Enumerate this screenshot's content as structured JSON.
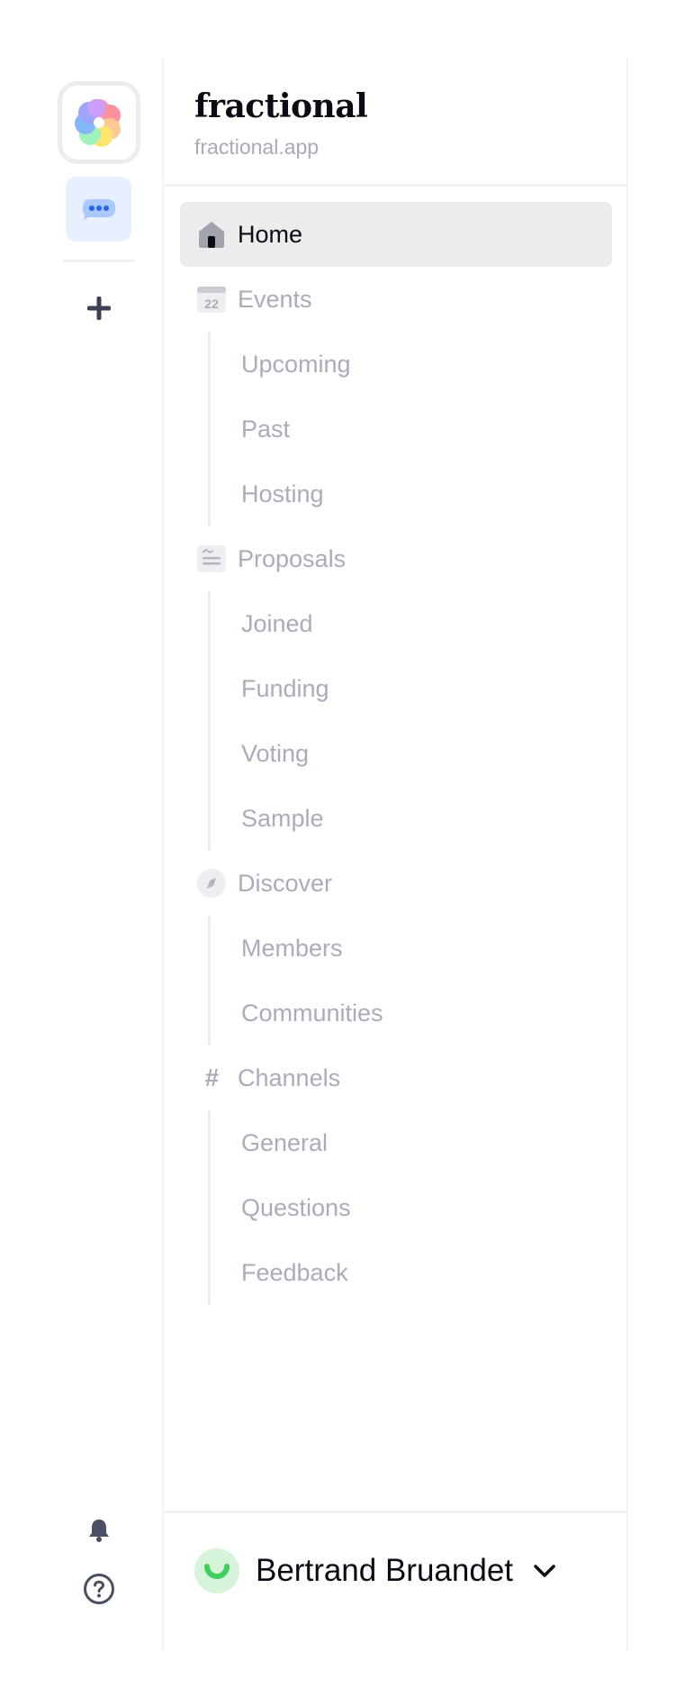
{
  "brand": {
    "title": "fractional",
    "subtitle": "fractional.app"
  },
  "rail": {
    "icons": [
      "flower-logo-icon",
      "chat-bubble-icon",
      "plus-icon",
      "bell-icon",
      "help-icon"
    ]
  },
  "nav": {
    "home": "Home",
    "events": {
      "label": "Events",
      "calendar_day": "22",
      "items": [
        "Upcoming",
        "Past",
        "Hosting"
      ]
    },
    "proposals": {
      "label": "Proposals",
      "items": [
        "Joined",
        "Funding",
        "Voting",
        "Sample"
      ]
    },
    "discover": {
      "label": "Discover",
      "items": [
        "Members",
        "Communities"
      ]
    },
    "channels": {
      "label": "Channels",
      "hash": "#",
      "items": [
        "General",
        "Questions",
        "Feedback"
      ]
    }
  },
  "user": {
    "name": "Bertrand Bruandet"
  },
  "colors": {
    "active_bg": "#ececee",
    "muted_text": "#a9acba",
    "accent_blue": "#3b82f6",
    "avatar_green": "#3fcf5a"
  }
}
